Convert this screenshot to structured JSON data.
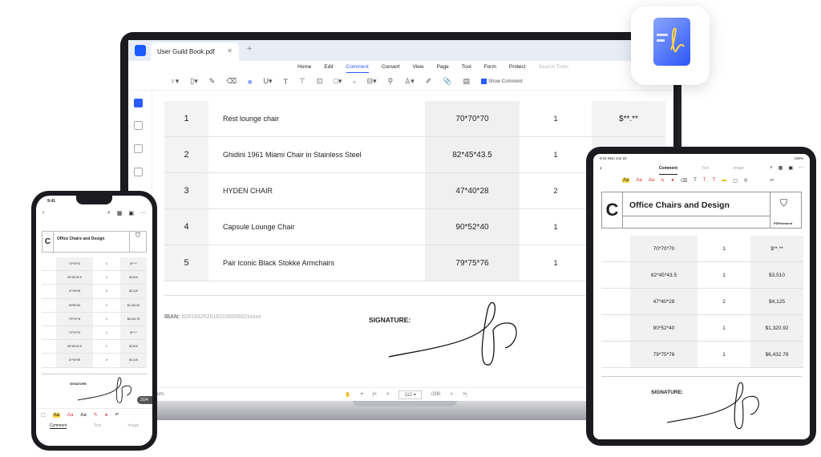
{
  "desktop": {
    "tab_title": "User Guild Book.pdf",
    "menu": [
      "Home",
      "Edit",
      "Comment",
      "Convert",
      "View",
      "Page",
      "Tool",
      "Form",
      "Protect"
    ],
    "active_menu": "Comment",
    "search_placeholder": "Search Tools",
    "show_comment_label": "Show Comment",
    "table": [
      {
        "num": "1",
        "name": "Rest lounge chair",
        "dims": "70*70*70",
        "qty": "1",
        "price": "$**.**"
      },
      {
        "num": "2",
        "name": "Ghidini 1961 Miami Chair in Stainless Steel",
        "dims": "82*45*43.5",
        "qty": "1",
        "price": ""
      },
      {
        "num": "3",
        "name": "HYDEN CHAIR",
        "dims": "47*40*28",
        "qty": "2",
        "price": ""
      },
      {
        "num": "4",
        "name": "Capsule Lounge Chair",
        "dims": "90*52*40",
        "qty": "1",
        "price": ""
      },
      {
        "num": "5",
        "name": "Pair Iconic Black Stokke Armchairs",
        "dims": "79*75*76",
        "qty": "1",
        "price": ""
      }
    ],
    "iban_label": "IBAN:",
    "iban_value": "It28193262016310000662xxxxx",
    "signature_label": "SIGNATURE:",
    "unit": "cm",
    "page_current": "112",
    "page_total": "/200"
  },
  "tablet": {
    "time": "9:41  Mon Jun 22",
    "battery": "100%",
    "tabs": [
      "Comment",
      "Text",
      "Image"
    ],
    "doc_title": "Office Chairs and Design",
    "logo_letter": "C",
    "brand": "PDFelement",
    "table": [
      {
        "dims": "70*70*70",
        "qty": "1",
        "price": "$**.**"
      },
      {
        "dims": "82*45*43.5",
        "qty": "1",
        "price": "$3,510"
      },
      {
        "dims": "47*40*28",
        "qty": "2",
        "price": "$4,125"
      },
      {
        "dims": "90*52*40",
        "qty": "1",
        "price": "$1,320.92"
      },
      {
        "dims": "79*75*76",
        "qty": "1",
        "price": "$6,432.78"
      }
    ],
    "signature_label": "SIGNATURE:"
  },
  "phone": {
    "time": "9:41",
    "doc_title": "Office Chairs and Design",
    "logo_letter": "C",
    "table": [
      {
        "dims": "70*70*70",
        "qty": "1",
        "price": "$**.**"
      },
      {
        "dims": "82*45*43.5",
        "qty": "1",
        "price": "$3,510"
      },
      {
        "dims": "47*40*28",
        "qty": "2",
        "price": "$4,125"
      },
      {
        "dims": "90*52*40",
        "qty": "1",
        "price": "$1,320.92"
      },
      {
        "dims": "79*75*76",
        "qty": "1",
        "price": "$6,432.78"
      },
      {
        "dims": "70*70*70",
        "qty": "1",
        "price": "$**.**"
      },
      {
        "dims": "82*45*43.5",
        "qty": "1",
        "price": "$3,510"
      },
      {
        "dims": "47*40*28",
        "qty": "2",
        "price": "$4,125"
      }
    ],
    "signature_label": "SIGNATURE:",
    "page_indicator": "3/24",
    "tabs": [
      "Comment",
      "Text",
      "Image"
    ]
  },
  "colors": {
    "accent": "#2a5cff",
    "highlight": "#ffd54a"
  }
}
